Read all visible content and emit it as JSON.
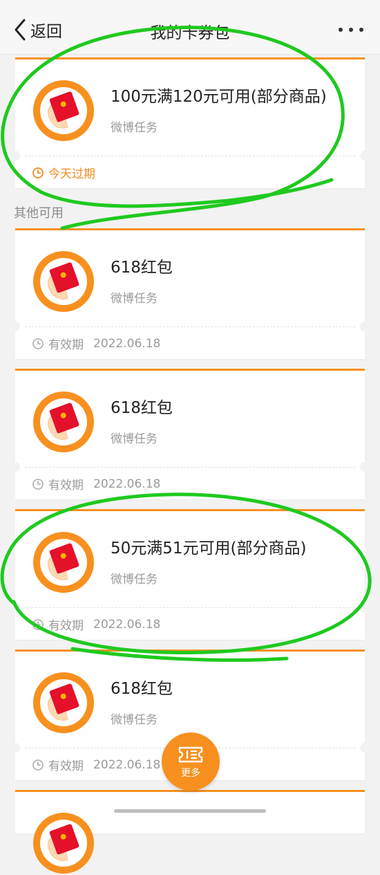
{
  "header": {
    "back_label": "返回",
    "title": "我的卡券包"
  },
  "colors": {
    "accent": "#f7901e",
    "warning": "#f08a1c",
    "annotation": "#1fc91f"
  },
  "section_other": "其他可用",
  "cards": [
    {
      "title": "100元满120元可用(部分商品)",
      "source": "微博任务",
      "status": "今天过期"
    },
    {
      "title": "618红包",
      "source": "微博任务",
      "validity_label": "有效期",
      "date": "2022.06.18"
    },
    {
      "title": "618红包",
      "source": "微博任务",
      "validity_label": "有效期",
      "date": "2022.06.18"
    },
    {
      "title": "50元满51元可用(部分商品)",
      "source": "微博任务",
      "validity_label": "有效期",
      "date": "2022.06.18"
    },
    {
      "title": "618红包",
      "source": "微博任务",
      "validity_label": "有效期",
      "date": "2022.06.18"
    }
  ],
  "fab": {
    "label": "更多"
  }
}
